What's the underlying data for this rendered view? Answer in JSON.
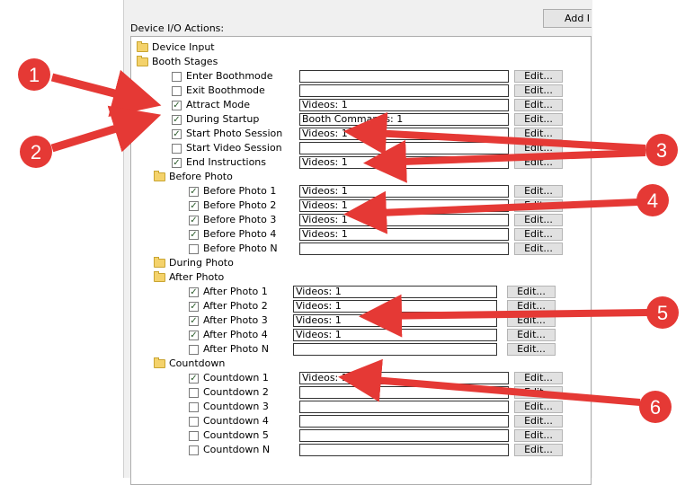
{
  "toolbar": {
    "add_label": "Add I"
  },
  "section_title": "Device I/O Actions:",
  "tree": [
    {
      "type": "folder",
      "label": "Device Input",
      "indent": 0
    },
    {
      "type": "folder",
      "label": "Booth Stages",
      "indent": 0
    },
    {
      "type": "item",
      "label": "Enter Boothmode",
      "checked": false,
      "value": "",
      "indent": 1
    },
    {
      "type": "item",
      "label": "Exit Boothmode",
      "checked": false,
      "value": "",
      "indent": 1
    },
    {
      "type": "item",
      "label": "Attract Mode",
      "checked": true,
      "value": "Videos: 1",
      "indent": 1
    },
    {
      "type": "item",
      "label": "During Startup",
      "checked": true,
      "value": "Booth Commands: 1",
      "indent": 1
    },
    {
      "type": "item",
      "label": "Start Photo Session",
      "checked": true,
      "value": "Videos: 1",
      "indent": 1
    },
    {
      "type": "item",
      "label": "Start Video Session",
      "checked": false,
      "value": "",
      "indent": 1
    },
    {
      "type": "item",
      "label": "End Instructions",
      "checked": true,
      "value": "Videos: 1",
      "indent": 1
    },
    {
      "type": "folder",
      "label": "Before Photo",
      "indent": 1
    },
    {
      "type": "item",
      "label": "Before Photo 1",
      "checked": true,
      "value": "Videos: 1",
      "indent": 2
    },
    {
      "type": "item",
      "label": "Before Photo 2",
      "checked": true,
      "value": "Videos: 1",
      "indent": 2
    },
    {
      "type": "item",
      "label": "Before Photo 3",
      "checked": true,
      "value": "Videos: 1",
      "indent": 2
    },
    {
      "type": "item",
      "label": "Before Photo 4",
      "checked": true,
      "value": "Videos: 1",
      "indent": 2
    },
    {
      "type": "item",
      "label": "Before Photo N",
      "checked": false,
      "value": "",
      "indent": 2
    },
    {
      "type": "folder",
      "label": "During Photo",
      "indent": 1
    },
    {
      "type": "folder",
      "label": "After Photo",
      "indent": 1
    },
    {
      "type": "item",
      "label": "After Photo 1",
      "checked": true,
      "value": "Videos: 1",
      "indent": 2,
      "narrow": true
    },
    {
      "type": "item",
      "label": "After Photo 2",
      "checked": true,
      "value": "Videos: 1",
      "indent": 2,
      "narrow": true
    },
    {
      "type": "item",
      "label": "After Photo 3",
      "checked": true,
      "value": "Videos: 1",
      "indent": 2,
      "narrow": true
    },
    {
      "type": "item",
      "label": "After Photo 4",
      "checked": true,
      "value": "Videos: 1",
      "indent": 2,
      "narrow": true
    },
    {
      "type": "item",
      "label": "After Photo N",
      "checked": false,
      "value": "",
      "indent": 2,
      "narrow": true
    },
    {
      "type": "folder",
      "label": "Countdown",
      "indent": 1
    },
    {
      "type": "item",
      "label": "Countdown 1",
      "checked": true,
      "value": "Videos: 1",
      "indent": 2
    },
    {
      "type": "item",
      "label": "Countdown 2",
      "checked": false,
      "value": "",
      "indent": 2
    },
    {
      "type": "item",
      "label": "Countdown 3",
      "checked": false,
      "value": "",
      "indent": 2
    },
    {
      "type": "item",
      "label": "Countdown 4",
      "checked": false,
      "value": "",
      "indent": 2
    },
    {
      "type": "item",
      "label": "Countdown 5",
      "checked": false,
      "value": "",
      "indent": 2
    },
    {
      "type": "item",
      "label": "Countdown N",
      "checked": false,
      "value": "",
      "indent": 2
    }
  ],
  "edit_label": "Edit...",
  "callouts": [
    "1",
    "2",
    "3",
    "4",
    "5",
    "6"
  ],
  "colors": {
    "callout": "#e53935",
    "folder": "#f4d26b",
    "check": "#2b5b2b"
  }
}
